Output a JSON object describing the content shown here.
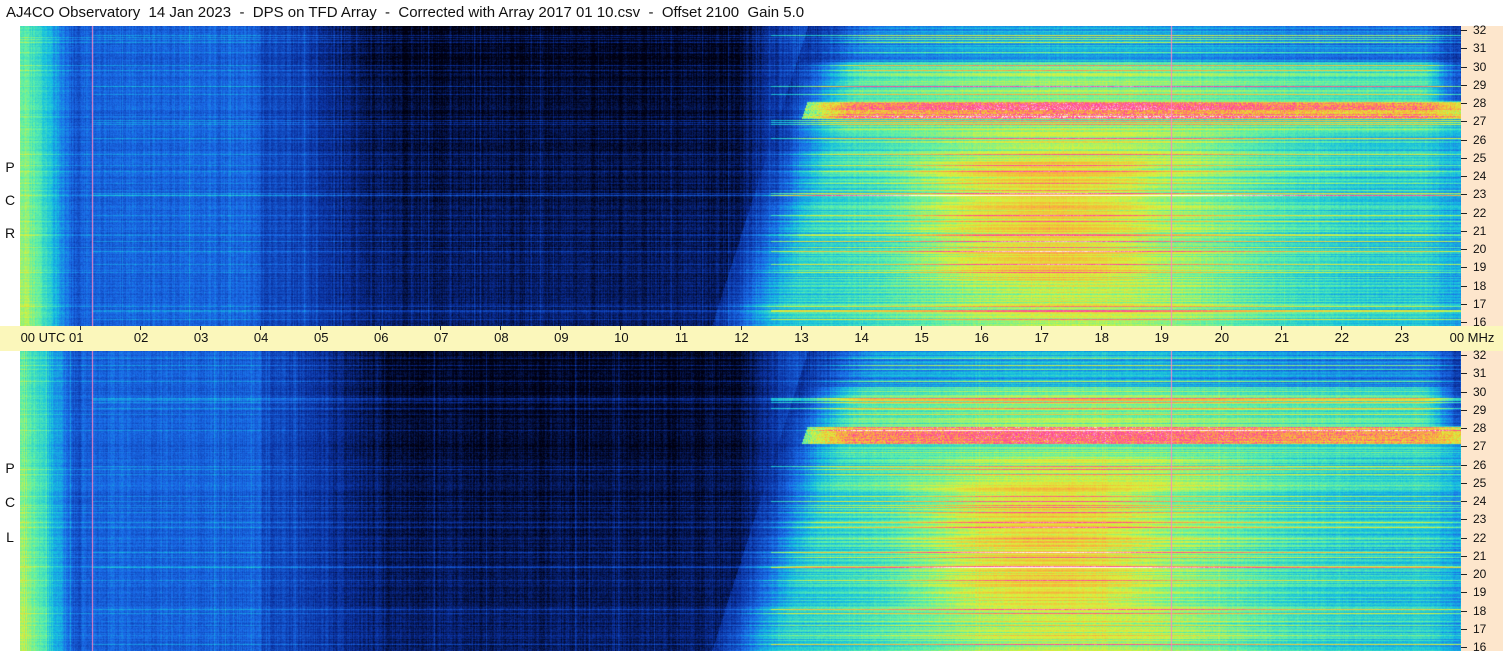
{
  "title": "AJ4CO Observatory  14 Jan 2023  -  DPS on TFD Array  -  Corrected with Array 2017 01 10.csv  -  Offset 2100  Gain 5.0",
  "panels": [
    {
      "id": "rcp",
      "letters": [
        "P",
        "C",
        "R"
      ]
    },
    {
      "id": "lcp",
      "letters": [
        "P",
        "C",
        "L"
      ]
    }
  ],
  "time_axis": {
    "labels": [
      "00  UTC  01",
      "02",
      "03",
      "04",
      "05",
      "06",
      "07",
      "08",
      "09",
      "10",
      "11",
      "12",
      "13",
      "14",
      "15",
      "16",
      "17",
      "18",
      "19",
      "20",
      "21",
      "22",
      "23",
      "00 MHz"
    ]
  },
  "freq_axis": {
    "labels": [
      "32",
      "31",
      "30",
      "29",
      "28",
      "27",
      "26",
      "25",
      "24",
      "23",
      "22",
      "21",
      "20",
      "19",
      "18",
      "17",
      "16"
    ]
  },
  "chart_data": {
    "type": "heatmap",
    "title": "AJ4CO Observatory  14 Jan 2023  -  DPS on TFD Array  -  Corrected with Array 2017 01 10.csv  -  Offset 2100  Gain 5.0",
    "x_unit": "UTC",
    "y_unit": "MHz",
    "xlim_hours": [
      0,
      24
    ],
    "ylim_mhz": [
      16,
      32
    ],
    "colormap": [
      "#000010",
      "#0a2f9c",
      "#1a6be8",
      "#16c0e0",
      "#5ef0a8",
      "#d8f23c",
      "#fab23a",
      "#ff3fa0",
      "#ffffff"
    ],
    "series": [
      {
        "name": "RCP",
        "vertical_lines_utc": [
          1.2,
          19.17
        ]
      },
      {
        "name": "LCP",
        "vertical_lines_utc": [
          1.2,
          19.17
        ]
      }
    ]
  }
}
